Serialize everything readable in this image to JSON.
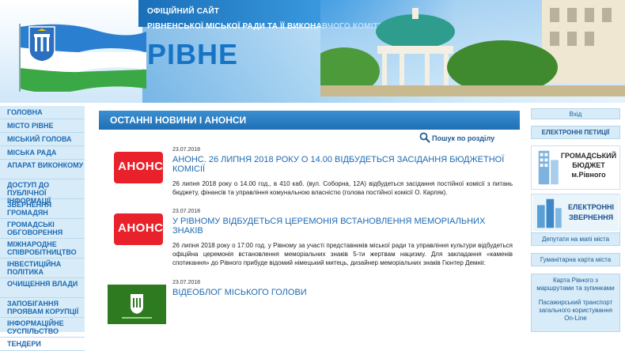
{
  "header": {
    "site_kind": "ОФІЦІЙНИЙ САЙТ",
    "site_sub": "РІВНЕНСЬКОЇ МІСЬКОЇ РАДИ ТА ЇЇ ВИКОНАВЧОГО КОМІТЕТУ",
    "city_name": "РІВНЕ"
  },
  "leftnav": {
    "items": [
      "ГОЛОВНА",
      "МІСТО РІВНЕ",
      "МІСЬКИЙ ГОЛОВА",
      "МІСЬКА РАДА",
      "АПАРАТ ВИКОНКОМУ",
      "ДОСТУП ДО ПУБЛІЧНОЇ ІНФОРМАЦІЇ",
      "ЗВЕРНЕННЯ ГРОМАДЯН",
      "ГРОМАДСЬКІ ОБГОВОРЕННЯ",
      "МІЖНАРОДНЕ СПІВРОБІТНИЦТВО",
      "ІНВЕСТИЦІЙНА ПОЛІТИКА",
      "ОЧИЩЕННЯ ВЛАДИ",
      "ЗАПОБІГАННЯ ПРОЯВАМ КОРУПЦІЇ",
      "ІНФОРМАЦІЙНЕ СУСПІЛЬСТВО",
      "ТЕНДЕРИ"
    ]
  },
  "main": {
    "section_title": "ОСТАННІ НОВИНИ І АНОНСИ",
    "search_label": "Пошук по розділу",
    "news": [
      {
        "date": "23.07.2018",
        "badge": "АНОНС",
        "title": "АНОНС. 26 ЛИПНЯ 2018 РОКУ О 14.00 ВІДБУДЕТЬСЯ ЗАСІДАННЯ БЮДЖЕТНОЇ КОМІСІЇ",
        "body": "26 липня 2018 року о 14.00 год., в 410 каб. (вул. Соборна, 12А) відбудеться засідання постійної комісії з питань бюджету, фінансів та управління комунальною власністю (голова постійної комісії О. Карпяк)."
      },
      {
        "date": "23.07.2018",
        "badge": "АНОНС",
        "title": "У РІВНОМУ ВІДБУДЕТЬСЯ ЦЕРЕМОНІЯ ВСТАНОВЛЕННЯ МЕМОРІАЛЬНИХ ЗНАКІВ",
        "body": "26 липня 2018 року о 17:00 год. у Рівному за участі представників міської ради та управління культури відбудеться офіційна церемонія встановлення меморіальних знаків 5-ти жертвам нацизму. Для закладання «каменів спотикання» до Рівного прибуде відомий німецький митець, дизайнер меморіальних знаків Гюнтер Демніг."
      },
      {
        "date": "23.07.2018",
        "title": "ВІДЕОБЛОГ МІСЬКОГО ГОЛОВИ"
      }
    ]
  },
  "right": {
    "login": "Вхід",
    "petitions": "ЕЛЕКТРОННІ ПЕТИЦІЇ",
    "budget_line1": "ГРОМАДСЬКИЙ",
    "budget_line2": "БЮДЖЕТ",
    "budget_line3": "м.Рівного",
    "appeals_line1": "ЕЛЕКТРОННІ",
    "appeals_line2": "ЗВЕРНЕННЯ",
    "deputies_map": "Депутати на мапі міста",
    "humanitarian_map": "Гуманітарна карта міста",
    "city_map": "Карта Рівного з маршрутами та зупинками",
    "transport": "Пасажирський транспорт загального користування On-Line"
  },
  "colors": {
    "accent_blue": "#1d6ab3",
    "nav_bg": "#d7ecf8",
    "anons_red": "#e8212a"
  }
}
